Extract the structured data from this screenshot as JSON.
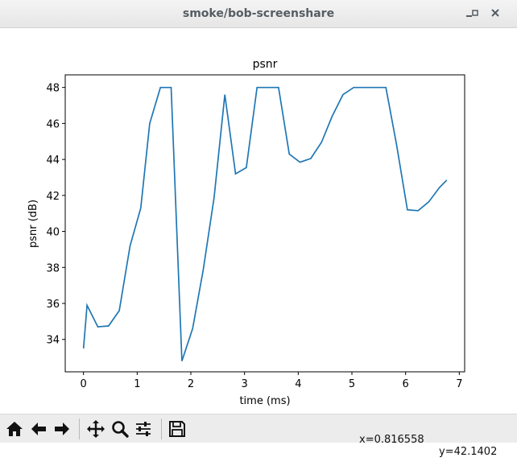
{
  "window": {
    "title": "smoke/bob-screenshare",
    "minimize_icon": "minimize-icon",
    "maximize_icon": "maximize-icon",
    "close_icon": "close-icon"
  },
  "toolbar": {
    "buttons": [
      {
        "name": "home-button",
        "icon": "home-icon"
      },
      {
        "name": "back-button",
        "icon": "left-arrow-icon"
      },
      {
        "name": "forward-button",
        "icon": "right-arrow-icon"
      },
      {
        "name": "pan-button",
        "icon": "move-icon"
      },
      {
        "name": "zoom-button",
        "icon": "magnifier-icon"
      },
      {
        "name": "configure-subplots-button",
        "icon": "sliders-icon"
      },
      {
        "name": "save-button",
        "icon": "floppy-disk-icon"
      }
    ],
    "x_readout": "x=0.816558",
    "y_readout": "y=42.1402"
  },
  "chart_data": {
    "type": "line",
    "title": "psnr",
    "xlabel": "time (ms)",
    "ylabel": "psnr (dB)",
    "xlim": [
      -0.34,
      7.1
    ],
    "ylim": [
      32.2,
      48.7
    ],
    "xticks": [
      0,
      1,
      2,
      3,
      4,
      5,
      6,
      7
    ],
    "yticks": [
      34,
      36,
      38,
      40,
      42,
      44,
      46,
      48
    ],
    "grid": false,
    "color": "#1f77b4",
    "series": [
      {
        "x": [
          0.0,
          0.067,
          0.267,
          0.467,
          0.667,
          0.867,
          1.067,
          1.233,
          1.433,
          1.633,
          1.833,
          2.033,
          2.233,
          2.433,
          2.633,
          2.833,
          3.033,
          3.233,
          3.433,
          3.633,
          3.833,
          4.033,
          4.233,
          4.433,
          4.633,
          4.833,
          5.033,
          5.233,
          5.433,
          5.633,
          5.833,
          6.033,
          6.233,
          6.433,
          6.633,
          6.767
        ],
        "y": [
          33.5,
          35.9,
          34.7,
          34.75,
          35.6,
          39.2,
          41.3,
          46.0,
          48.0,
          48.0,
          32.8,
          34.6,
          37.9,
          41.9,
          47.6,
          43.2,
          43.55,
          48.0,
          48.0,
          48.0,
          44.3,
          43.85,
          44.05,
          44.95,
          46.4,
          47.6,
          48.0,
          48.0,
          48.0,
          48.0,
          44.8,
          41.2,
          41.15,
          41.65,
          42.45,
          42.85
        ]
      }
    ]
  }
}
